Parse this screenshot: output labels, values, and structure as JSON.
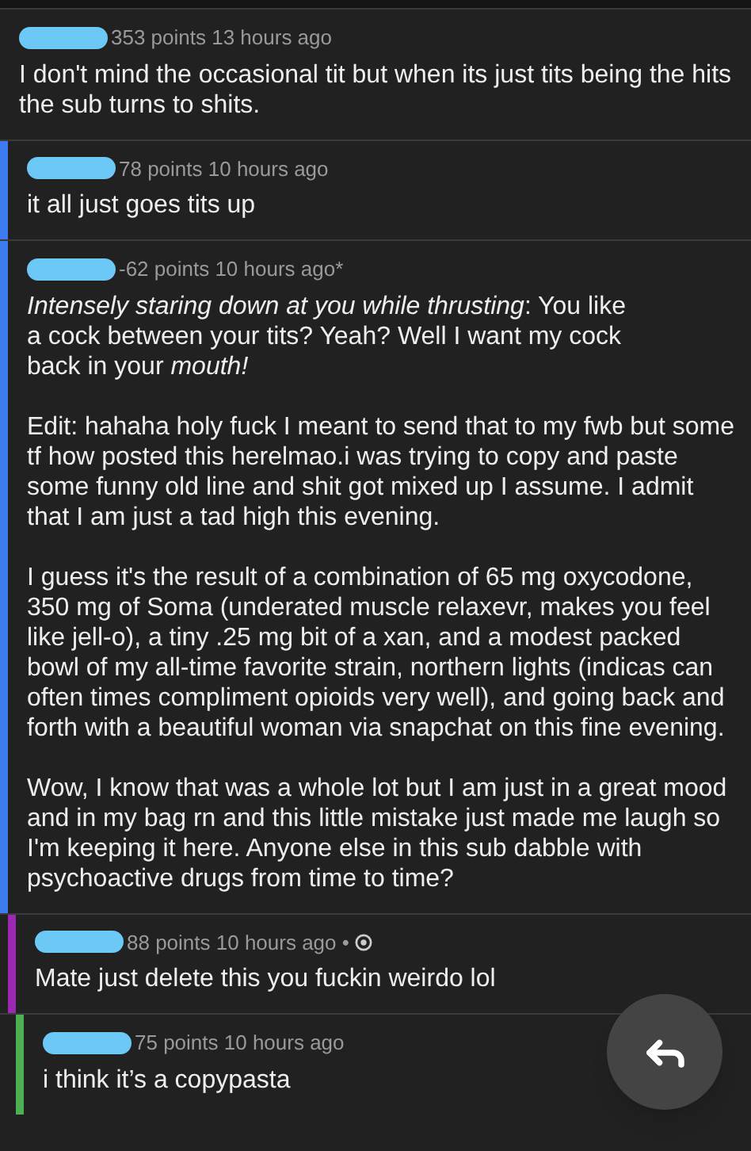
{
  "comments": [
    {
      "meta": "353 points 13 hours ago",
      "award": false,
      "paragraphs": [
        [
          "I don't mind the occasional tit but when its just tits being the hits the sub turns to shits."
        ]
      ],
      "children": [
        {
          "meta": "78 points 10 hours ago",
          "award": false,
          "color": "#3d7bf0",
          "paragraphs": [
            [
              "it all just goes tits up"
            ]
          ]
        },
        {
          "meta": "-62 points 10 hours ago*",
          "award": false,
          "color": "#3d7bf0",
          "paragraphs": [
            [
              "*Intensely staring down at you while thrusting*: You like",
              "a cock between your tits? Yeah? Well I want my cock",
              "back in your *mouth!*"
            ],
            [
              "Edit: hahaha holy fuck I meant to send that to my fwb but some tf how posted this herelmao.i was trying to copy and paste some funny old line and shit got mixed up I assume. I admit that I am just a tad high this evening."
            ],
            [
              "I guess it's the result of a combination of 65 mg oxycodone, 350 mg of Soma (underated muscle relaxevr, makes you feel like jell-o), a tiny .25 mg bit of a xan, and a modest packed bowl of my all-time favorite strain, northern lights (indicas can often times compliment opioids very well), and going back and forth with a beautiful woman via snapchat on this fine evening."
            ],
            [
              "Wow, I know that was a whole lot but I am just in a great mood and in my bag rn and this little mistake just made me laugh so I'm keeping it here. Anyone else in this sub dabble with psychoactive drugs from time to time?"
            ]
          ],
          "children": [
            {
              "meta": "88 points 10 hours ago •",
              "award": true,
              "color": "#9c27b0",
              "paragraphs": [
                [
                  "Mate just delete this you fuckin weirdo lol"
                ]
              ],
              "children": [
                {
                  "meta": "75 points 10 hours ago",
                  "award": false,
                  "color": "#4caf50",
                  "paragraphs": [
                    [
                      "i think it’s a copypasta"
                    ]
                  ]
                }
              ]
            }
          ]
        }
      ]
    }
  ]
}
